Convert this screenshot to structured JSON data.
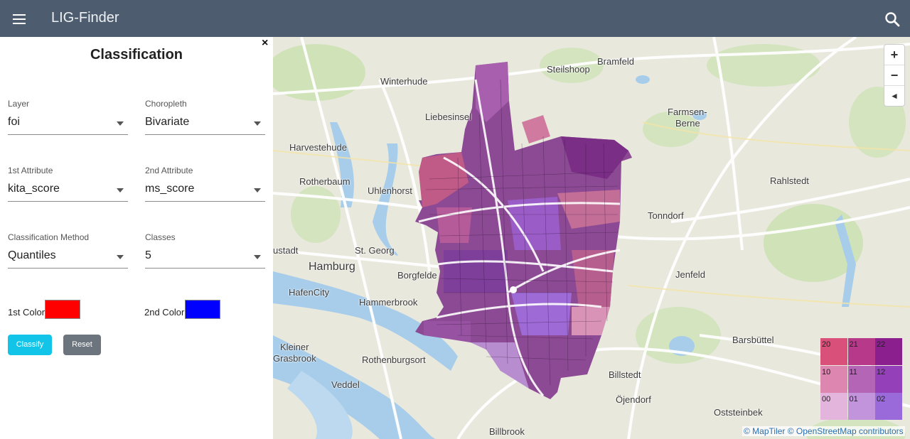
{
  "app": {
    "title": "LIG-Finder"
  },
  "panel": {
    "title": "Classification",
    "layer": {
      "label": "Layer",
      "value": "foi"
    },
    "choropleth": {
      "label": "Choropleth",
      "value": "Bivariate"
    },
    "attr1": {
      "label": "1st Attribute",
      "value": "kita_score"
    },
    "attr2": {
      "label": "2nd Attribute",
      "value": "ms_score"
    },
    "method": {
      "label": "Classification Method",
      "value": "Quantiles"
    },
    "classes": {
      "label": "Classes",
      "value": "5"
    },
    "color1": {
      "label": "1st Color",
      "value": "#ff0000"
    },
    "color2": {
      "label": "2nd Color",
      "value": "#0000ff"
    },
    "classify_label": "Classify",
    "reset_label": "Reset",
    "close_label": "×"
  },
  "map": {
    "places": [
      "Steilshoop",
      "Bramfeld",
      "Winterhude",
      "Liebesinsel",
      "Farmsen-",
      "Berne",
      "Harvestehude",
      "Rotherbaum",
      "Uhlenhorst",
      "Rahlstedt",
      "Tonndorf",
      "ustadt",
      "St. Georg",
      "Hamburg",
      "Borgfelde",
      "HafenCity",
      "Jenfeld",
      "Hammerbrook",
      "Kleiner",
      "Grasbrook",
      "Rothenburgsort",
      "Barsbüttel",
      "Billstedt",
      "Veddel",
      "Öjendorf",
      "Oststeinbek",
      "Billbrook"
    ],
    "zoom_in": "+",
    "zoom_out": "−",
    "compass": "◄"
  },
  "legend": {
    "cells": [
      {
        "code": "20",
        "color": "#d9507a"
      },
      {
        "code": "21",
        "color": "#b73a8a"
      },
      {
        "code": "22",
        "color": "#8b1f8e"
      },
      {
        "code": "10",
        "color": "#dd86b0"
      },
      {
        "code": "11",
        "color": "#b565b5"
      },
      {
        "code": "12",
        "color": "#9440b9"
      },
      {
        "code": "00",
        "color": "#e4b5dc"
      },
      {
        "code": "01",
        "color": "#c294dc"
      },
      {
        "code": "02",
        "color": "#9a6ada"
      }
    ]
  },
  "attribution": {
    "maptiler": "© MapTiler",
    "osm": "© OpenStreetMap contributors"
  },
  "colors": {
    "topbar": "#4d5d6f",
    "classify": "#12c5e8",
    "reset": "#6c757d"
  }
}
